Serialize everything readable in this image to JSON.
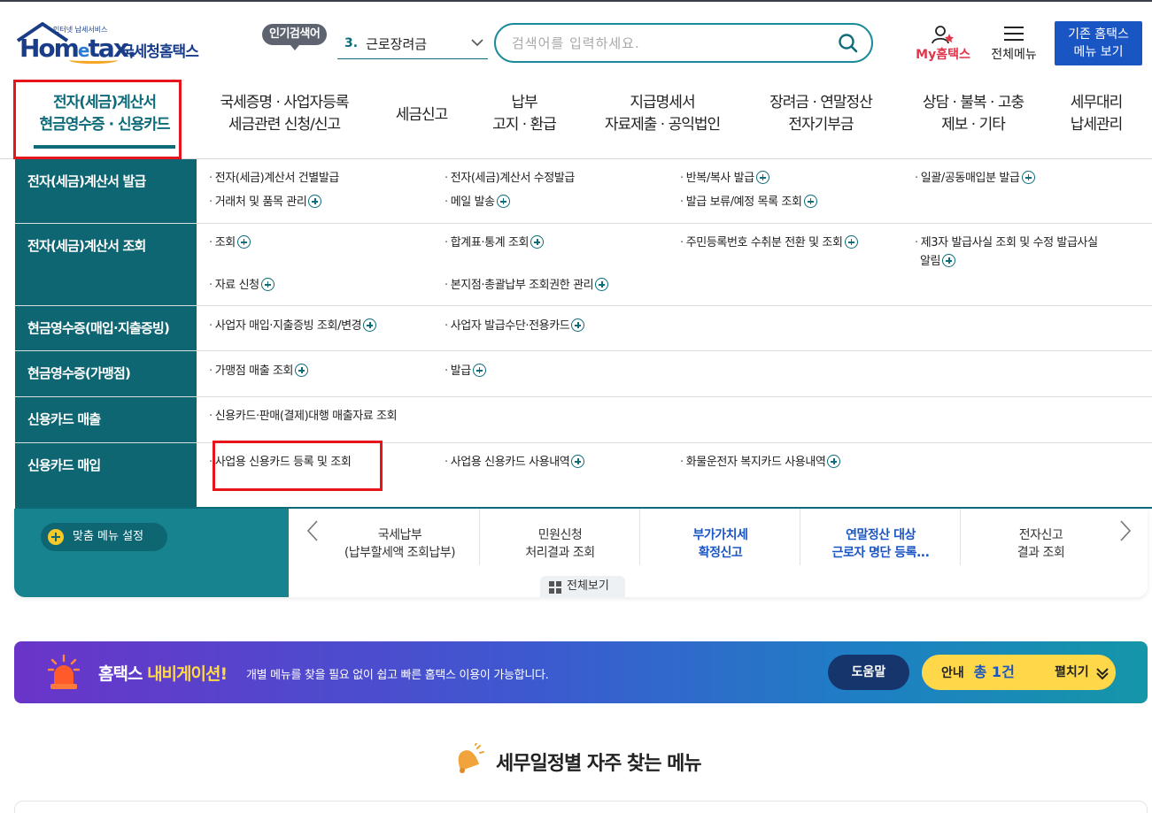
{
  "header": {
    "logo_small": "인터넷 납세서비스",
    "logo_main": "Hom",
    "logo_e": "e",
    "logo_tail": "tax.",
    "logo_nts": "국세청홈택스",
    "popular_badge": "인기검색어",
    "popular_rank": "3.",
    "popular_term": "근로장려금",
    "search_placeholder": "검색어를 입력하세요.",
    "my_prefix": "My",
    "my_suffix": "홈택스",
    "all_menu": "전체메뉴",
    "old_button_line1": "기존 홈택스",
    "old_button_line2": "메뉴 보기"
  },
  "gnb": [
    {
      "line1": "전자(세금)계산서",
      "line2": "현금영수증 · 신용카드"
    },
    {
      "line1": "국세증명 · 사업자등록",
      "line2": "세금관련 신청/신고"
    },
    {
      "line1": "세금신고",
      "line2": ""
    },
    {
      "line1": "납부",
      "line2": "고지 · 환급"
    },
    {
      "line1": "지급명세서",
      "line2": "자료제출 · 공익법인"
    },
    {
      "line1": "장려금 · 연말정산",
      "line2": "전자기부금"
    },
    {
      "line1": "상담 · 불복 · 고충",
      "line2": "제보 · 기타"
    },
    {
      "line1": "세무대리",
      "line2": "납세관리"
    }
  ],
  "panel": {
    "rows": [
      {
        "category": "전자(세금)계산서 발급",
        "links": [
          "전자(세금)계산서 건별발급",
          "전자(세금)계산서 수정발급",
          "반복/복사 발급",
          "일괄/공동매입분 발급",
          "거래처 및 품목 관리",
          "메일 발송",
          "발급 보류/예정 목록 조회"
        ]
      },
      {
        "category": "전자(세금)계산서 조회",
        "links": [
          "조회",
          "합계표·통계 조회",
          "주민등록번호 수취분 전환 및 조회",
          "제3자 발급사실 조회 및 수정 발급사실",
          "알림",
          "자료 신청",
          "본지점·총괄납부 조회권한 관리"
        ]
      },
      {
        "category": "현금영수증(매입·지출증빙)",
        "links": [
          "사업자 매입·지출증빙 조회/변경",
          "사업자 발급수단·전용카드"
        ]
      },
      {
        "category": "현금영수증(가맹점)",
        "links": [
          "가맹점 매출 조회",
          "발급"
        ]
      },
      {
        "category": "신용카드 매출",
        "links": [
          "신용카드·판매(결제)대행 매출자료 조회"
        ]
      },
      {
        "category": "신용카드 매입",
        "links": [
          "사업용 신용카드 등록 및 조회",
          "사업용 신용카드 사용내역",
          "화물운전자 복지카드 사용내역"
        ]
      }
    ]
  },
  "quick": {
    "custom_label": "맞춤 메뉴 설정",
    "items": [
      {
        "line1": "국세납부",
        "line2": "(납부할세액 조회납부)"
      },
      {
        "line1": "민원신청",
        "line2": "처리결과 조회"
      },
      {
        "line1": "부가가치세",
        "line2": "확정신고"
      },
      {
        "line1": "연말정산 대상",
        "line2": "근로자 명단 등록..."
      },
      {
        "line1": "전자신고",
        "line2": "결과 조회"
      }
    ],
    "view_all": "전체보기"
  },
  "banner": {
    "title_white": "홈택스 ",
    "title_yellow": "내비게이션!",
    "desc": "개별 메뉴를 찾을 필요 없이 쉽고 빠른 홈택스 이용이 가능합니다.",
    "help": "도움말",
    "notice_label": "안내",
    "notice_count": "총 1건",
    "expand": "펼치기"
  },
  "section_title": "세무일정별 자주 찾는 메뉴",
  "colors": {
    "teal": "#0f6673",
    "accent_blue": "#1a55c4",
    "highlight_red": "#e8141c",
    "yellow": "#ffd84a"
  }
}
